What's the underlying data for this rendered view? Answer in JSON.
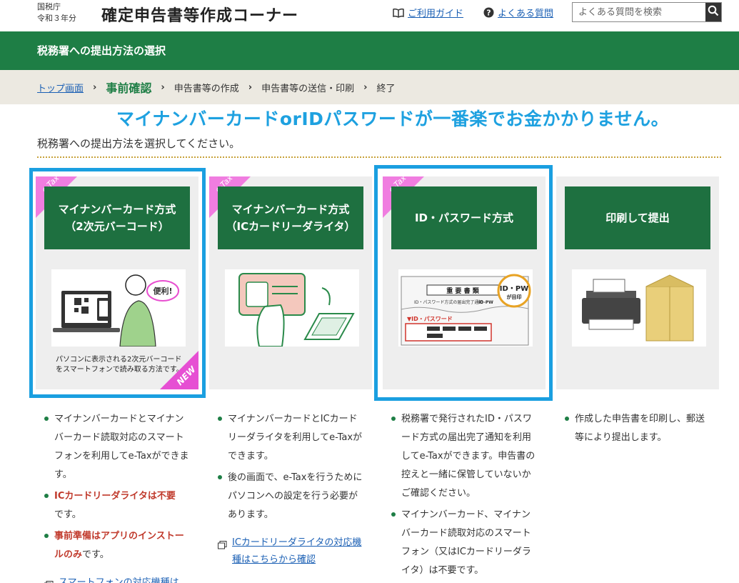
{
  "header": {
    "agency": "国税庁",
    "year": "令和３年分",
    "app_title": "確定申告書等作成コーナー",
    "guide_link": "ご利用ガイド",
    "faq_link": "よくある質問",
    "search_placeholder": "よくある質問を検索",
    "icons": [
      "book-icon",
      "question-icon",
      "search-icon"
    ]
  },
  "band": {
    "title": "税務署への提出方法の選択"
  },
  "breadcrumb": {
    "items": [
      "トップ画面",
      "事前確認",
      "申告書等の作成",
      "申告書等の送信・印刷",
      "終了"
    ],
    "current": "事前確認"
  },
  "promo": "マイナンバーカードorIDパスワードが一番楽でお金かかりません。",
  "instruction": "税務署への提出方法を選択してください。",
  "cards": [
    {
      "badge": "e-Tax",
      "line1": "マイナンバーカード方式",
      "line2": "（2次元バーコード）",
      "caption1": "パソコンに表示される2次元バーコード",
      "caption2": "をスマートフォンで読み取る方法です。",
      "new_badge": "NEW",
      "bubble": "便利!"
    },
    {
      "badge": "e-Tax",
      "line1": "マイナンバーカード方式",
      "line2": "（ICカードリーダライタ）"
    },
    {
      "badge": "e-Tax",
      "line1": "ID・パスワード方式",
      "doc_title": "重 要 書 類",
      "doc_sub": "ID・パスワード方式の届出完了通知",
      "doc_idpw": "ID-PW",
      "doc_label": "▼ID・パスワード",
      "seal1": "ID・PW",
      "seal2": "が目印"
    },
    {
      "line1": "印刷して提出"
    }
  ],
  "col1": {
    "b1": "マイナンバーカードとマイナンバーカード読取対応のスマートフォンを利用してe-Taxができます。",
    "b2_red": "ICカードリーダライタは不要",
    "b2_tail": "です。",
    "b3_red": "事前準備はアプリのインストールのみ",
    "b3_tail": "です。",
    "link": "スマートフォンの対応機種は"
  },
  "col2": {
    "b1": "マイナンバーカードとICカードリーダライタを利用してe-Taxができます。",
    "b2": "後の画面で、e-Taxを行うためにパソコンへの設定を行う必要があります。",
    "link": "ICカードリーダライタの対応機種はこちらから確認"
  },
  "col3": {
    "b1": "税務署で発行されたID・パスワード方式の届出完了通知を利用してe-Taxができます。申告書の控えと一緒に保管していないかご確認ください。",
    "b2": "マイナンバーカード、マイナンバーカード読取対応のスマートフォン（又はICカードリーダライタ）は不要です。"
  },
  "col4": {
    "b1": "作成した申告書を印刷し、郵送等により提出します。"
  },
  "colors": {
    "green": "#1e7e45",
    "card_green": "#1e7040",
    "blue": "#1ea1e0",
    "pink": "#f07de0",
    "link": "#1a5fb4",
    "red": "#c0392b"
  }
}
